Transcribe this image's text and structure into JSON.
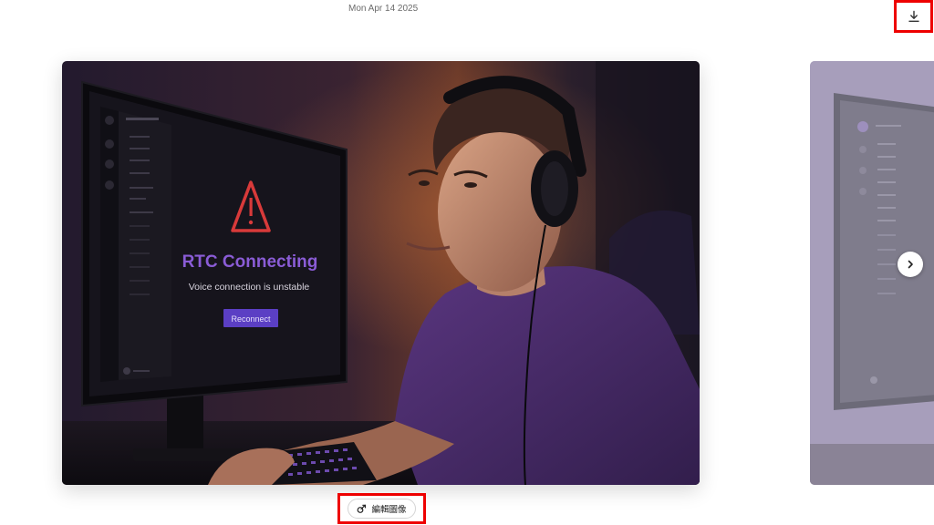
{
  "header": {
    "date": "Mon Apr 14 2025"
  },
  "toolbar": {
    "download_icon": "download-icon"
  },
  "image": {
    "screen_heading": "RTC Connecting",
    "screen_message": "Voice connection is unstable",
    "screen_button": "Reconnect",
    "warning_icon": "warning-triangle-icon",
    "colors": {
      "heading": "#8a5cd6",
      "button": "#5b3fc4",
      "warning": "#d83a3a",
      "shirt": "#4b2d6e"
    }
  },
  "carousel": {
    "next_icon": "chevron-right-icon"
  },
  "edit_button": {
    "label": "編輯圖像",
    "icon": "edit-image-icon"
  }
}
